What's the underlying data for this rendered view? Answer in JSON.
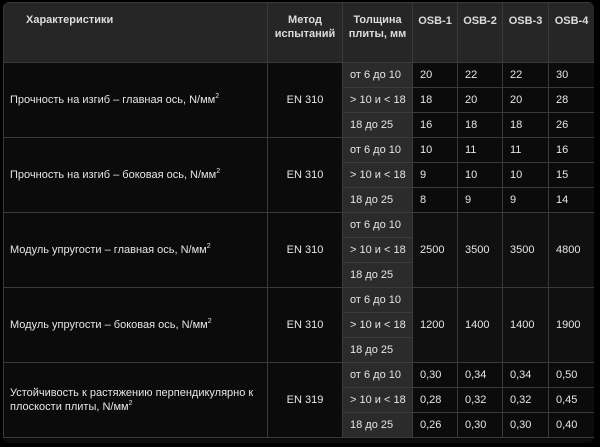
{
  "headers": {
    "characteristics": "Характеристики",
    "method": "Метод испытаний",
    "thickness": "Толщина плиты, мм",
    "osb": [
      "OSB-1",
      "OSB-2",
      "OSB-3",
      "OSB-4"
    ]
  },
  "unit_superscript": "2",
  "rows": [
    {
      "label": "Прочность на изгиб – главная ось, N/мм",
      "method": "EN 310",
      "thickness": [
        "от 6 до 10",
        "> 10 и < 18",
        "18 до 25"
      ],
      "values": [
        [
          "20",
          "22",
          "22",
          "30"
        ],
        [
          "18",
          "20",
          "20",
          "28"
        ],
        [
          "16",
          "18",
          "18",
          "26"
        ]
      ]
    },
    {
      "label": "Прочность на изгиб – боковая ось, N/мм",
      "method": "EN 310",
      "thickness": [
        "от 6 до 10",
        "> 10 и < 18",
        "18 до 25"
      ],
      "values": [
        [
          "10",
          "11",
          "11",
          "16"
        ],
        [
          "9",
          "10",
          "10",
          "15"
        ],
        [
          "8",
          "9",
          "9",
          "14"
        ]
      ]
    },
    {
      "label": "Модуль упругости – главная ось, N/мм",
      "method": "EN 310",
      "thickness": [
        "от 6 до 10",
        "> 10 и < 18",
        "18 до 25"
      ],
      "values": [
        "2500",
        "3500",
        "3500",
        "4800"
      ]
    },
    {
      "label": "Модуль упругости – боковая ось, N/мм",
      "method": "EN 310",
      "thickness": [
        "от 6 до 10",
        "> 10 и < 18",
        "18 до 25"
      ],
      "values": [
        "1200",
        "1400",
        "1400",
        "1900"
      ]
    },
    {
      "label": "Устойчивость к растяжению перпендикулярно к плоскости плиты, N/мм",
      "method": "EN 319",
      "thickness": [
        "от 6 до 10",
        "> 10 и < 18",
        "18 до 25"
      ],
      "values": [
        [
          "0,30",
          "0,34",
          "0,34",
          "0,50"
        ],
        [
          "0,28",
          "0,32",
          "0,32",
          "0,45"
        ],
        [
          "0,26",
          "0,30",
          "0,30",
          "0,40"
        ]
      ]
    }
  ]
}
